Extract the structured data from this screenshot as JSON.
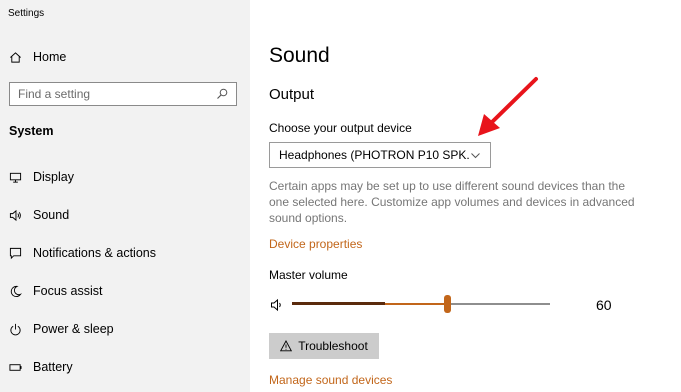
{
  "window": {
    "title": "Settings"
  },
  "sidebar": {
    "home": {
      "label": "Home",
      "icon": "home-icon"
    },
    "search": {
      "placeholder": "Find a setting",
      "icon": "search-icon"
    },
    "section": "System",
    "items": [
      {
        "label": "Display",
        "icon": "display-icon"
      },
      {
        "label": "Sound",
        "icon": "speaker-icon"
      },
      {
        "label": "Notifications & actions",
        "icon": "notification-icon"
      },
      {
        "label": "Focus assist",
        "icon": "moon-icon"
      },
      {
        "label": "Power & sleep",
        "icon": "power-icon"
      },
      {
        "label": "Battery",
        "icon": "battery-icon"
      }
    ]
  },
  "main": {
    "title": "Sound",
    "output": {
      "heading": "Output",
      "device_label": "Choose your output device",
      "device_value": "Headphones (PHOTRON P10 SPK...",
      "help": "Certain apps may be set up to use different sound devices than the one selected here. Customize app volumes and devices in advanced sound options.",
      "device_properties_link": "Device properties",
      "master_volume_label": "Master volume",
      "volume_value": "60",
      "troubleshoot_label": "Troubleshoot",
      "manage_link": "Manage sound devices"
    }
  },
  "colors": {
    "accent": "#c2661a",
    "annotation_arrow": "#e8141b"
  }
}
